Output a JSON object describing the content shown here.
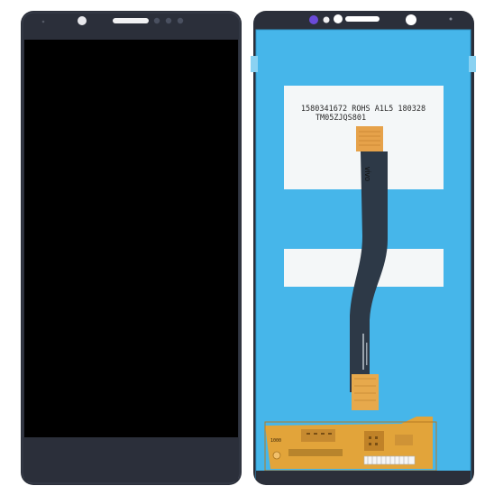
{
  "front": {
    "logo_text": ""
  },
  "back": {
    "sticker_line1": "1580341672 ROHS A1L5 180328",
    "sticker_line2": "TM05ZJQS801",
    "flex_brand": "vivo",
    "pcb_label": "1000"
  },
  "colors": {
    "bezel": "#2b2f3a",
    "screen": "#000000",
    "back_panel": "#46b6ea",
    "sticker": "#f4f7f8",
    "flex": "#2d3947",
    "pcb": "#e2a43a"
  }
}
